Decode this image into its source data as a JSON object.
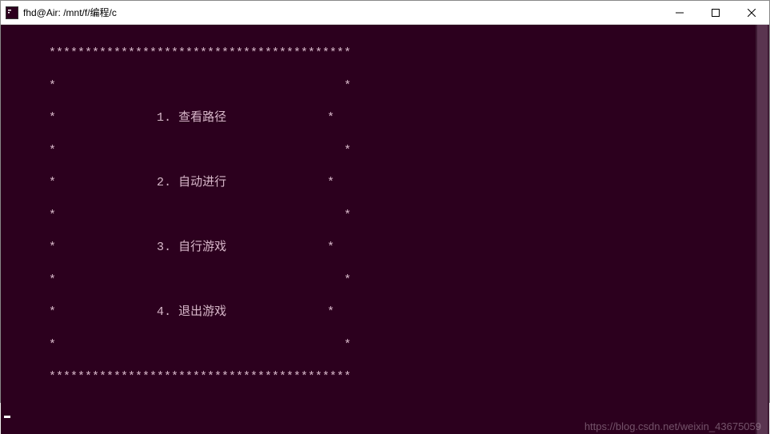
{
  "window": {
    "title": "fhd@Air: /mnt/f/编程/c"
  },
  "menu": {
    "border_top": "******************************************",
    "row_blank_l": "*",
    "row_blank_r": "*",
    "items": [
      {
        "n": "1",
        "label": "查看路径"
      },
      {
        "n": "2",
        "label": "自动进行"
      },
      {
        "n": "3",
        "label": "自行游戏"
      },
      {
        "n": "4",
        "label": "退出游戏"
      }
    ],
    "border_bottom": "******************************************"
  },
  "watermark": "https://blog.csdn.net/weixin_43675059"
}
